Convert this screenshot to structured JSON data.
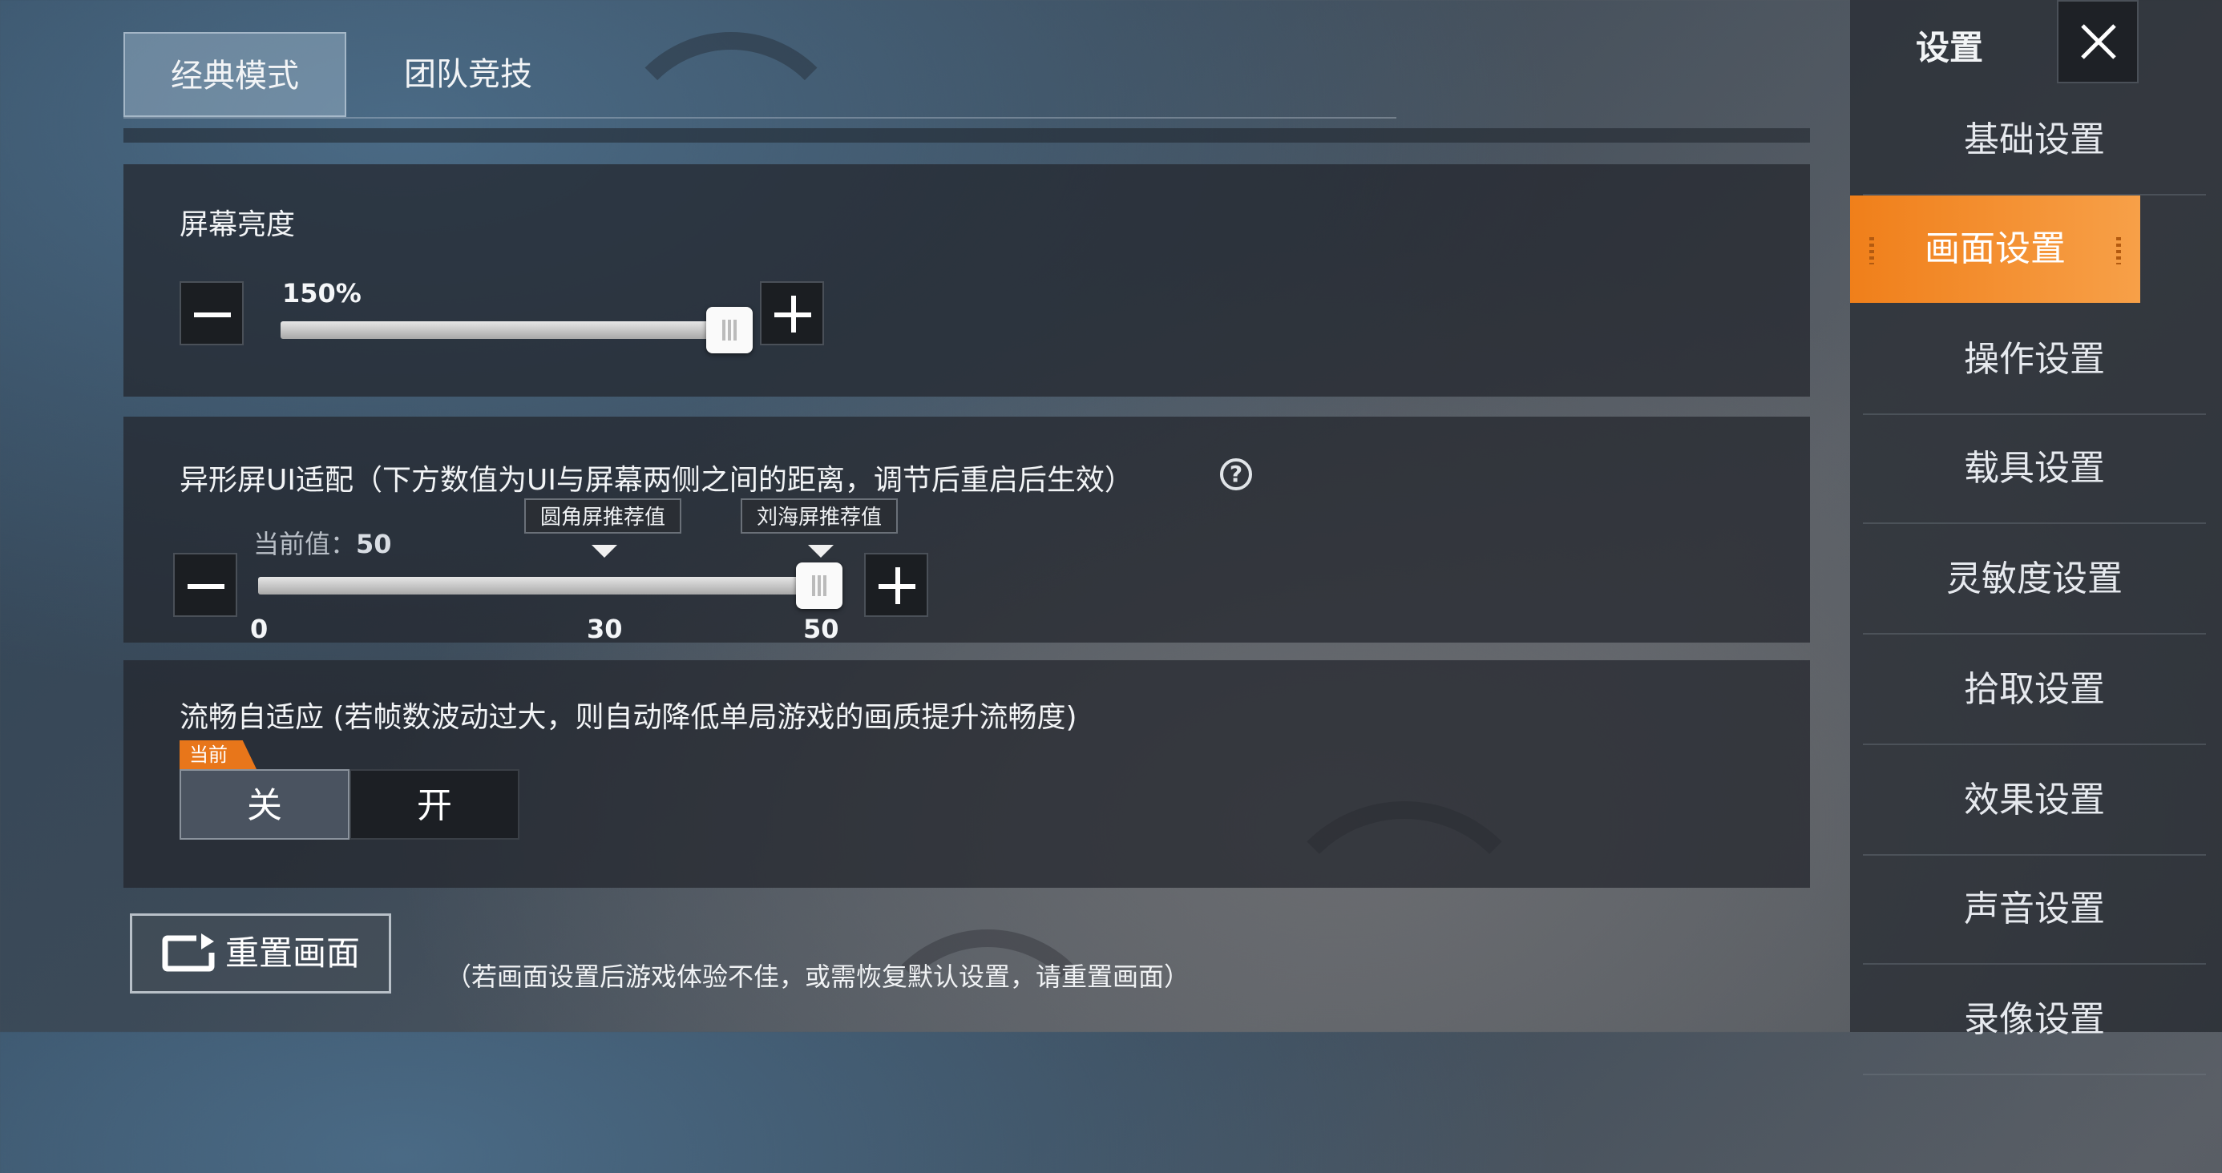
{
  "tabs": [
    {
      "label": "经典模式",
      "active": true
    },
    {
      "label": "团队竞技",
      "active": false
    }
  ],
  "brightness": {
    "title": "屏幕亮度",
    "value_label": "150%",
    "level": 1.0
  },
  "notch": {
    "title": "异形屏UI适配（下方数值为UI与屏幕两侧之间的距离，调节后重启后生效）",
    "help_symbol": "?",
    "current_label": "当前值：",
    "current_value": "50",
    "tooltip_round": "圆角屏推荐值",
    "tooltip_notch": "刘海屏推荐值",
    "ticks": [
      "0",
      "30",
      "50"
    ],
    "value": 50,
    "max": 50
  },
  "smooth": {
    "title": "流畅自适应 (若帧数波动过大，则自动降低单局游戏的画质提升流畅度)",
    "badge": "当前",
    "off_label": "关",
    "on_label": "开",
    "selected": "off"
  },
  "reset": {
    "label": "重置画面",
    "note": "（若画面设置后游戏体验不佳，或需恢复默认设置，请重置画面）"
  },
  "sidebar": {
    "title": "设置",
    "items": [
      {
        "label": "基础设置",
        "active": false
      },
      {
        "label": "画面设置",
        "active": true
      },
      {
        "label": "操作设置",
        "active": false
      },
      {
        "label": "载具设置",
        "active": false
      },
      {
        "label": "灵敏度设置",
        "active": false
      },
      {
        "label": "拾取设置",
        "active": false
      },
      {
        "label": "效果设置",
        "active": false
      },
      {
        "label": "声音设置",
        "active": false
      },
      {
        "label": "录像设置",
        "active": false
      }
    ]
  },
  "colors": {
    "accent": "#f07f1a",
    "panel": "#22262d"
  },
  "icons": {
    "close": "close-icon",
    "minus": "minus-icon",
    "plus": "plus-icon",
    "help": "help-circle-icon",
    "reset": "reset-screen-icon"
  }
}
